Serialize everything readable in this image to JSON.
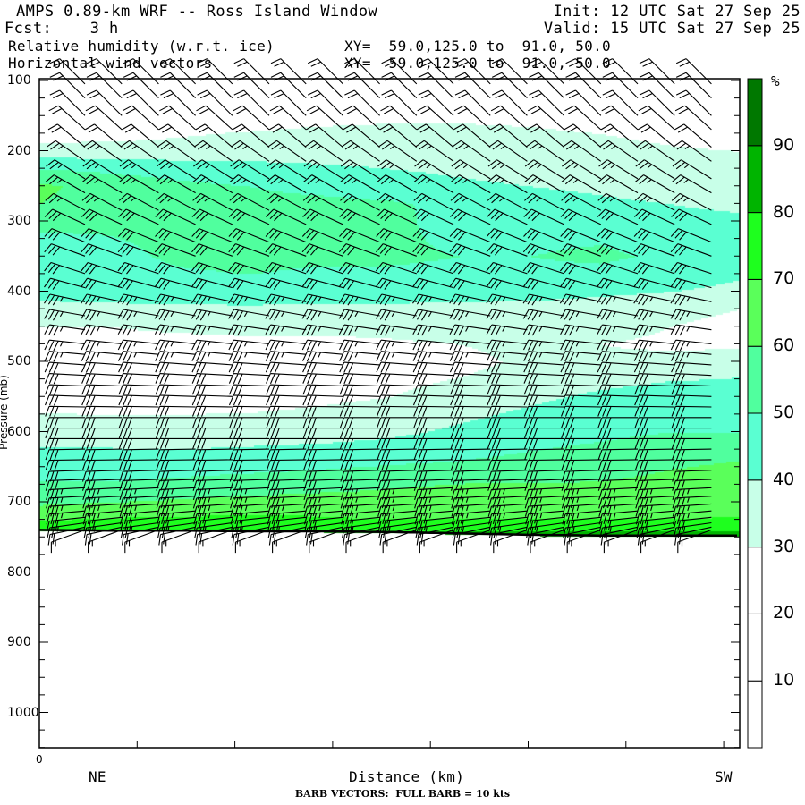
{
  "header": {
    "title": "AMPS 0.89-km WRF -- Ross Island Window",
    "init": "Init: 12 UTC Sat 27 Sep 25",
    "fcst": "Fcst:    3 h",
    "valid": "Valid: 15 UTC Sat 27 Sep 25",
    "field1": "Relative humidity (w.r.t. ice)",
    "field1_xy": "XY=  59.0,125.0 to  91.0, 50.0",
    "field2": "Horizontal wind vectors",
    "field2_xy": "XY=  59.0,125.0 to  91.0, 50.0"
  },
  "chart_data": {
    "type": "heatmap",
    "title": "Relative humidity (w.r.t. ice) and horizontal wind barbs cross-section",
    "xlabel": "Distance (km)",
    "ylabel": "Pressure (mb)",
    "x_start_label": "0",
    "x_left_label": "NE",
    "x_right_label": "SW",
    "y_ticks": [
      "100",
      "200",
      "300",
      "400",
      "500",
      "600",
      "700",
      "800",
      "900",
      "1000"
    ],
    "ylim": [
      1050,
      97.5
    ],
    "colorbar": {
      "unit": "%",
      "labels": [
        "90",
        "80",
        "70",
        "60",
        "50",
        "40",
        "30",
        "20",
        "10"
      ],
      "bins": [
        {
          "min": 0,
          "max": 10,
          "color": "#ffffff"
        },
        {
          "min": 10,
          "max": 20,
          "color": "#ffffff"
        },
        {
          "min": 20,
          "max": 30,
          "color": "#ffffff"
        },
        {
          "min": 30,
          "max": 40,
          "color": "#c8ffe8"
        },
        {
          "min": 40,
          "max": 50,
          "color": "#5affd2"
        },
        {
          "min": 50,
          "max": 60,
          "color": "#50ff9e"
        },
        {
          "min": 60,
          "max": 70,
          "color": "#5aff5a"
        },
        {
          "min": 70,
          "max": 80,
          "color": "#1eff1e"
        },
        {
          "min": 80,
          "max": 90,
          "color": "#00b400"
        },
        {
          "min": 90,
          "max": 100,
          "color": "#007800"
        }
      ]
    },
    "rh_grid": {
      "pressures": [
        100,
        150,
        175,
        200,
        225,
        250,
        275,
        300,
        350,
        400,
        425,
        450,
        475,
        500,
        550,
        600,
        640,
        680,
        710,
        730,
        745
      ],
      "rows": [
        [
          10,
          10,
          10,
          10,
          10,
          10,
          10,
          10,
          10,
          10,
          10
        ],
        [
          20,
          20,
          22,
          24,
          26,
          28,
          28,
          27,
          25,
          22,
          20
        ],
        [
          25,
          27,
          29,
          31,
          33,
          33,
          33,
          32,
          30,
          28,
          26
        ],
        [
          35,
          34,
          34,
          35,
          35,
          35,
          35,
          35,
          33,
          31,
          30
        ],
        [
          50,
          48,
          46,
          44,
          42,
          40,
          38,
          36,
          35,
          34,
          33
        ],
        [
          62,
          56,
          52,
          50,
          48,
          46,
          42,
          40,
          38,
          36,
          35
        ],
        [
          60,
          55,
          53,
          52,
          52,
          51,
          48,
          45,
          42,
          40,
          38
        ],
        [
          52,
          52,
          53,
          53,
          53,
          53,
          45,
          46,
          46,
          43,
          42
        ],
        [
          45,
          47,
          52,
          54,
          52,
          52,
          50,
          50,
          52,
          48,
          44
        ],
        [
          42,
          43,
          45,
          46,
          44,
          44,
          44,
          44,
          42,
          40,
          38
        ],
        [
          38,
          38,
          38,
          38,
          38,
          38,
          37,
          36,
          35,
          32,
          30
        ],
        [
          30,
          30,
          31,
          32,
          32,
          32,
          33,
          35,
          34,
          30,
          28
        ],
        [
          28,
          28,
          28,
          28,
          28,
          29,
          30,
          33,
          30,
          28,
          28
        ],
        [
          25,
          24,
          24,
          24,
          24,
          25,
          27,
          32,
          32,
          34,
          36
        ],
        [
          25,
          25,
          26,
          26,
          28,
          30,
          34,
          38,
          42,
          45,
          45
        ],
        [
          36,
          35,
          34,
          35,
          36,
          38,
          42,
          46,
          48,
          50,
          50
        ],
        [
          44,
          44,
          44,
          45,
          46,
          48,
          50,
          52,
          54,
          58,
          60
        ],
        [
          52,
          52,
          54,
          56,
          58,
          60,
          62,
          62,
          62,
          64,
          66
        ],
        [
          62,
          64,
          66,
          68,
          68,
          66,
          66,
          66,
          66,
          66,
          68
        ],
        [
          72,
          74,
          74,
          74,
          72,
          72,
          72,
          72,
          72,
          72,
          72
        ],
        [
          85,
          85,
          85,
          85,
          82,
          82,
          82,
          82,
          82,
          82,
          82
        ]
      ]
    },
    "surface_pressure": [
      740,
      741,
      741,
      742,
      742,
      743,
      745,
      747,
      748,
      748,
      748
    ],
    "wind": {
      "barb_note": "BARB VECTORS:  FULL BARB = 10 kts",
      "columns": 18,
      "levels": [
        {
          "p": 105,
          "angle": 45,
          "speed": 20
        },
        {
          "p": 125,
          "angle": 45,
          "speed": 20
        },
        {
          "p": 150,
          "angle": 45,
          "speed": 20
        },
        {
          "p": 170,
          "angle": 42,
          "speed": 20
        },
        {
          "p": 195,
          "angle": 40,
          "speed": 20
        },
        {
          "p": 215,
          "angle": 35,
          "speed": 25
        },
        {
          "p": 240,
          "angle": 32,
          "speed": 25
        },
        {
          "p": 260,
          "angle": 30,
          "speed": 25
        },
        {
          "p": 285,
          "angle": 28,
          "speed": 25
        },
        {
          "p": 305,
          "angle": 25,
          "speed": 30
        },
        {
          "p": 330,
          "angle": 22,
          "speed": 30
        },
        {
          "p": 350,
          "angle": 20,
          "speed": 30
        },
        {
          "p": 375,
          "angle": 18,
          "speed": 30
        },
        {
          "p": 395,
          "angle": 15,
          "speed": 30
        },
        {
          "p": 415,
          "angle": 12,
          "speed": 35
        },
        {
          "p": 435,
          "angle": 10,
          "speed": 35
        },
        {
          "p": 455,
          "angle": 8,
          "speed": 35
        },
        {
          "p": 475,
          "angle": 6,
          "speed": 35
        },
        {
          "p": 490,
          "angle": 5,
          "speed": 35
        },
        {
          "p": 505,
          "angle": 4,
          "speed": 30
        },
        {
          "p": 520,
          "angle": 3,
          "speed": 30
        },
        {
          "p": 535,
          "angle": 2,
          "speed": 30
        },
        {
          "p": 550,
          "angle": 2,
          "speed": 30
        },
        {
          "p": 565,
          "angle": 1,
          "speed": 30
        },
        {
          "p": 580,
          "angle": 0,
          "speed": 30
        },
        {
          "p": 595,
          "angle": 0,
          "speed": 30
        },
        {
          "p": 610,
          "angle": 0,
          "speed": 30
        },
        {
          "p": 625,
          "angle": -1,
          "speed": 30
        },
        {
          "p": 640,
          "angle": -1,
          "speed": 30
        },
        {
          "p": 655,
          "angle": -2,
          "speed": 30
        },
        {
          "p": 668,
          "angle": -2,
          "speed": 30
        },
        {
          "p": 680,
          "angle": -3,
          "speed": 35
        },
        {
          "p": 692,
          "angle": -3,
          "speed": 35
        },
        {
          "p": 703,
          "angle": -4,
          "speed": 35
        },
        {
          "p": 713,
          "angle": -5,
          "speed": 35
        },
        {
          "p": 722,
          "angle": -6,
          "speed": 30
        },
        {
          "p": 730,
          "angle": -8,
          "speed": 25
        },
        {
          "p": 736,
          "angle": -12,
          "speed": 20
        },
        {
          "p": 740,
          "angle": -20,
          "speed": 15
        }
      ]
    }
  }
}
